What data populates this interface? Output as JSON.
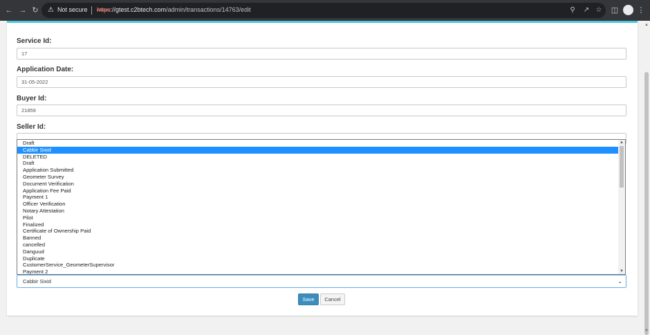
{
  "browser": {
    "security_label": "Not secure",
    "url_scheme": "https",
    "url_host": "://gtest.c2btech.com",
    "url_path": "/admin/transactions/14763/edit"
  },
  "form": {
    "service_id": {
      "label": "Service Id:",
      "value": "17"
    },
    "application_date": {
      "label": "Application Date:",
      "value": "31-05-2022"
    },
    "buyer_id": {
      "label": "Buyer Id:",
      "value": "21859"
    },
    "seller_id": {
      "label": "Seller Id:",
      "value": ""
    }
  },
  "status_dropdown": {
    "options": [
      "Draft",
      "Cabbir Sixid",
      "DELETED",
      "Draft",
      "Application Submitted",
      "Geometer Survey",
      "Document Verification",
      "Application Fee Paid",
      "Payment 1",
      "Officer Verification",
      "Notary Attestation",
      "Pilot",
      "Finalized",
      "Certificate of Ownership Paid",
      "Banned",
      "cancelled",
      "Danguud",
      "Duplicate",
      "CustomerService_GeometerSupervisor",
      "Payment 2"
    ],
    "highlighted_index": 1,
    "selected_value": "Cabbir Sixid"
  },
  "buttons": {
    "save": "Save",
    "cancel": "Cancel"
  },
  "colors": {
    "accent": "#49c5e0",
    "save_button": "#3c8dbc",
    "highlight": "#1e90ff"
  }
}
